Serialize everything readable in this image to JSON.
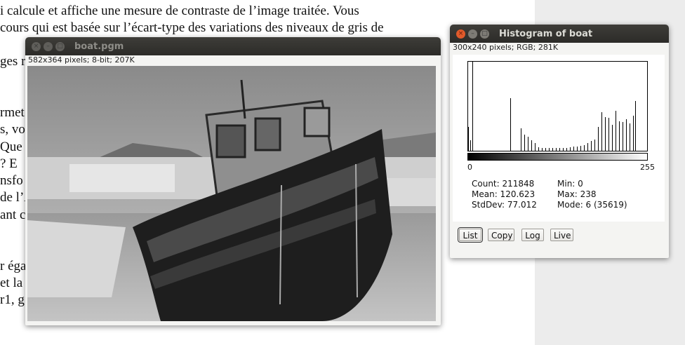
{
  "document": {
    "lines": [
      "i calcule et affiche une mesure de contraste de l’image traitée. Vous",
      "cours qui est basée sur l’écart-type des variations des niveaux de gris de",
      "ges r",
      "rmet",
      "s, vo",
      "Que",
      " ? E",
      "nsfo",
      "de l’A",
      "ant c",
      "r éga",
      "et la",
      "r1, g"
    ]
  },
  "boat_window": {
    "title": "boat.pgm",
    "info": "582x364 pixels; 8-bit; 207K",
    "image_alt": "boat photograph"
  },
  "hist_window": {
    "title": "Histogram of boat",
    "info": "300x240 pixels; RGB; 281K",
    "axis_min": "0",
    "axis_max": "255",
    "stats": {
      "count": "Count: 211848",
      "mean": "Mean: 120.623",
      "stddev": "StdDev: 77.012",
      "min": "Min: 0",
      "max": "Max: 238",
      "mode": "Mode: 6 (35619)"
    },
    "buttons": {
      "list": "List",
      "copy": "Copy",
      "log": "Log",
      "live": "Live"
    }
  },
  "colors": {
    "titlebar": "#2c2b28",
    "close_button": "#e05a2b",
    "window_bg": "#f4f4f2"
  },
  "chart_data": {
    "type": "bar",
    "title": "",
    "xlabel": "",
    "ylabel": "",
    "xlim": [
      0,
      255
    ],
    "ylim": [
      0,
      35619
    ],
    "x": [
      0,
      3,
      6,
      60,
      75,
      80,
      85,
      90,
      95,
      100,
      105,
      110,
      115,
      120,
      125,
      130,
      135,
      140,
      145,
      150,
      155,
      160,
      165,
      170,
      175,
      180,
      185,
      190,
      195,
      200,
      205,
      210,
      215,
      220,
      225,
      230,
      235,
      238
    ],
    "values": [
      9500,
      4200,
      35619,
      21000,
      9000,
      6500,
      5500,
      4200,
      3000,
      1400,
      1200,
      1100,
      1000,
      1050,
      1100,
      1150,
      1200,
      1250,
      1400,
      1600,
      1700,
      1900,
      2300,
      3000,
      3800,
      4600,
      9500,
      15500,
      13500,
      13200,
      10300,
      16100,
      11900,
      11500,
      12500,
      10900,
      14000,
      20000
    ]
  }
}
